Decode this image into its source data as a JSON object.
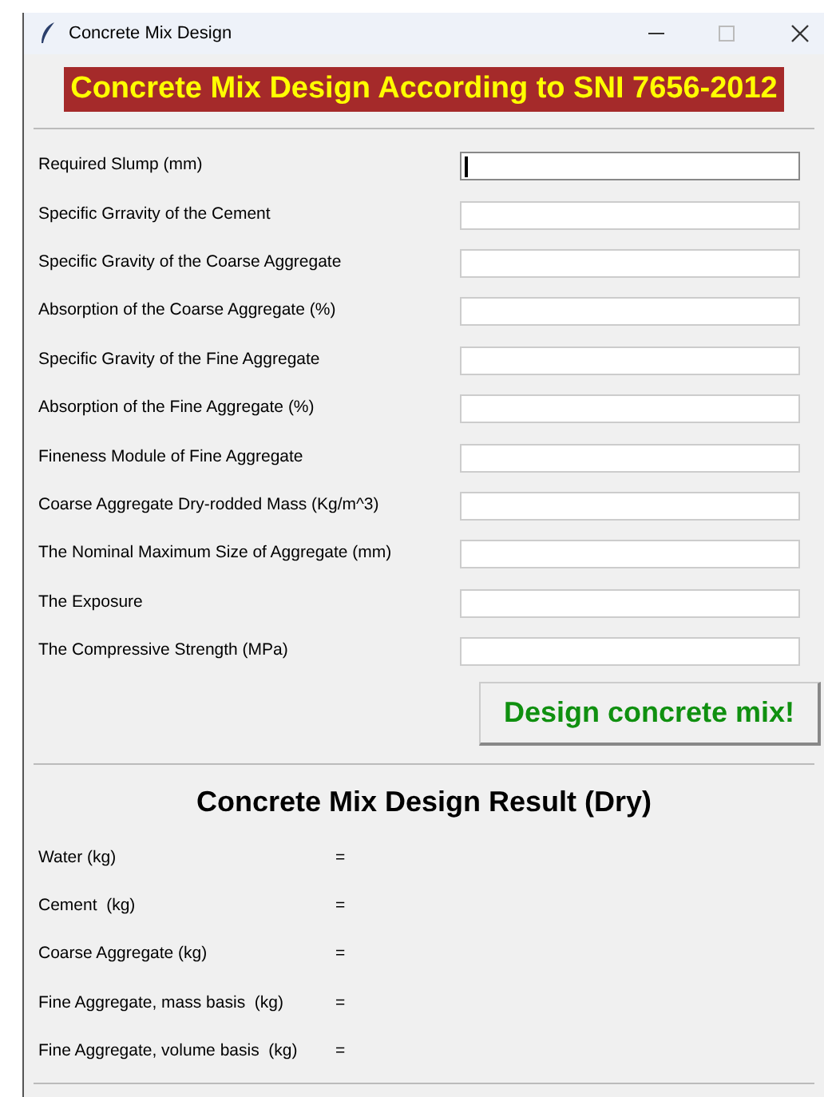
{
  "window": {
    "title": "Concrete Mix Design"
  },
  "banner": "Concrete Mix Design According to SNI 7656-2012",
  "inputs": [
    {
      "label": "Required Slump (mm)",
      "focused": true
    },
    {
      "label": "Specific Grravity of the Cement",
      "focused": false
    },
    {
      "label": "Specific Gravity of the Coarse Aggregate",
      "focused": false
    },
    {
      "label": "Absorption of the Coarse Aggregate (%)",
      "focused": false
    },
    {
      "label": "Specific Gravity of the Fine Aggregate",
      "focused": false
    },
    {
      "label": "Absorption of the Fine Aggregate (%)",
      "focused": false
    },
    {
      "label": "Fineness Module of Fine Aggregate",
      "focused": false
    },
    {
      "label": "Coarse Aggregate Dry-rodded Mass (Kg/m^3)",
      "focused": false
    },
    {
      "label": "The Nominal Maximum Size of Aggregate (mm)",
      "focused": false
    },
    {
      "label": "The Exposure",
      "focused": false
    },
    {
      "label": "The Compressive Strength (MPa)",
      "focused": false
    }
  ],
  "design_button": "Design concrete mix!",
  "results_title": "Concrete Mix Design Result (Dry)",
  "results": [
    {
      "label": "Water (kg)",
      "sign": "="
    },
    {
      "label": "Cement  (kg)",
      "sign": "="
    },
    {
      "label": "Coarse Aggregate (kg)",
      "sign": "="
    },
    {
      "label": "Fine Aggregate, mass basis  (kg)",
      "sign": "="
    },
    {
      "label": "Fine Aggregate, volume basis  (kg)",
      "sign": "="
    }
  ]
}
